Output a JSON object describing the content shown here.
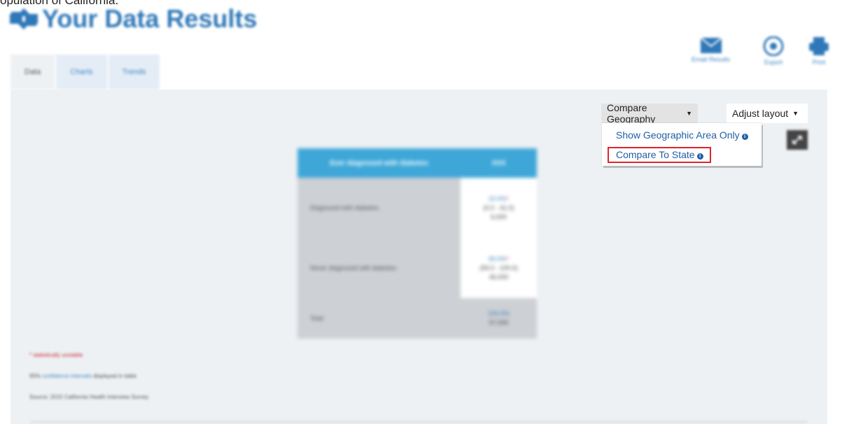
{
  "header": {
    "clipped_text": "opulation of California.",
    "title": "Your Data Results"
  },
  "tabs": [
    {
      "label": "Data",
      "active": true
    },
    {
      "label": "Charts",
      "active": false
    },
    {
      "label": "Trends",
      "active": false
    }
  ],
  "tools": {
    "email": {
      "label": "Email Results",
      "icon": "envelope-icon"
    },
    "export": {
      "label": "Export",
      "icon": "export-icon"
    },
    "print": {
      "label": "Print",
      "icon": "printer-icon"
    }
  },
  "controls": {
    "compare_geography": "Compare Geography",
    "adjust_layout": "Adjust layout"
  },
  "dropdown": {
    "items": [
      {
        "label": "Show Geographic Area Only",
        "highlighted": false
      },
      {
        "label": "Compare To State",
        "highlighted": true
      }
    ]
  },
  "table": {
    "headers": [
      "Ever diagnosed with diabetes",
      "XXX"
    ],
    "rows": [
      {
        "label": "Diagnosed with diabetes",
        "percent": "10.0%",
        "star": "*",
        "ci": "(0.0 - 41.0)",
        "count": "6,000"
      },
      {
        "label": "Never diagnosed with diabetes",
        "percent": "90.0%",
        "star": "*",
        "ci": "(59.0 - 100.0)",
        "count": "46,000"
      },
      {
        "label": "Total",
        "percent": "100.0%",
        "star": "",
        "ci": "",
        "count": "57,000"
      }
    ]
  },
  "footnotes": {
    "unstable": "* statistically unstable",
    "ci_prefix": "95%",
    "ci_link": "confidence intervals",
    "ci_suffix": "displayed in table",
    "source": "Source: 2015 California Health Interview Survey"
  },
  "colors": {
    "brand_blue": "#2f78b8",
    "table_header": "#3ea7d8",
    "highlight_red": "#e0242b"
  }
}
